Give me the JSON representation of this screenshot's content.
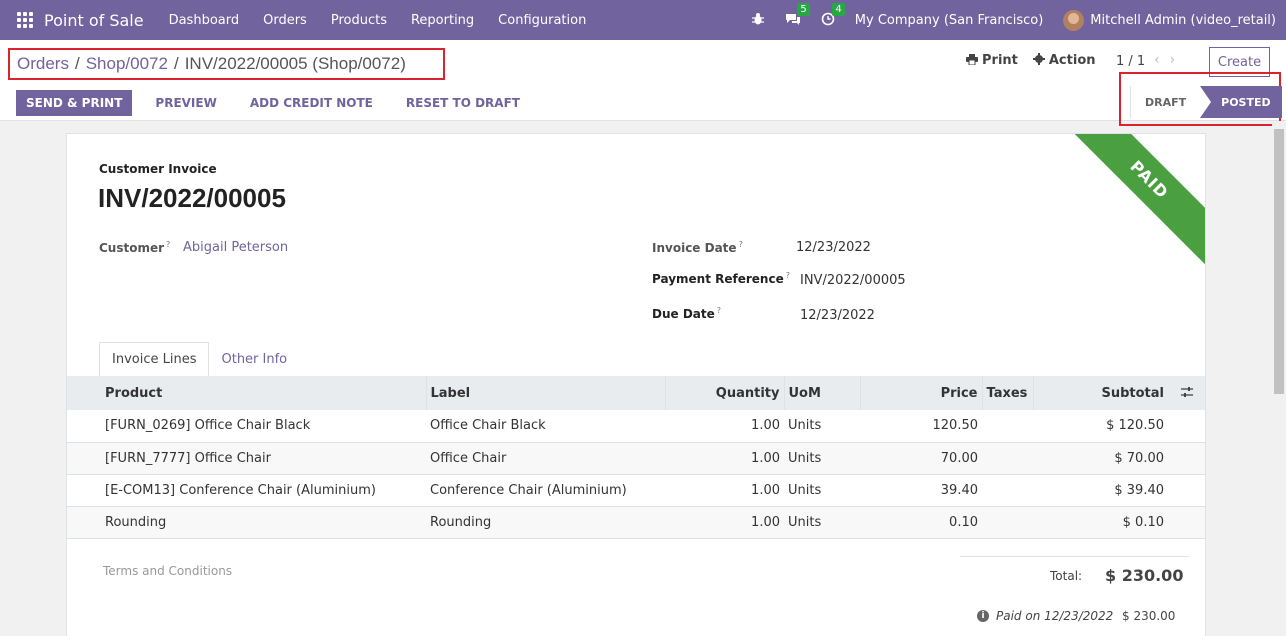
{
  "navbar": {
    "app_name": "Point of Sale",
    "menu": [
      "Dashboard",
      "Orders",
      "Products",
      "Reporting",
      "Configuration"
    ],
    "messages_count": "5",
    "activities_count": "4",
    "company": "My Company (San Francisco)",
    "user": "Mitchell Admin (video_retail)"
  },
  "breadcrumb": {
    "items": [
      "Orders",
      "Shop/0072"
    ],
    "current": "INV/2022/00005 (Shop/0072)"
  },
  "control": {
    "print_label": "Print",
    "action_label": "Action",
    "pager": "1 / 1",
    "create_label": "Create"
  },
  "buttons": {
    "send_print": "SEND & PRINT",
    "preview": "PREVIEW",
    "add_credit_note": "ADD CREDIT NOTE",
    "reset_to_draft": "RESET TO DRAFT"
  },
  "statusbar": {
    "draft": "DRAFT",
    "posted": "POSTED",
    "active": "POSTED"
  },
  "invoice": {
    "type": "Customer Invoice",
    "number": "INV/2022/00005",
    "ribbon": "PAID",
    "ribbon_color": "#4aa041",
    "customer_label": "Customer",
    "customer": "Abigail Peterson",
    "invoice_date_label": "Invoice Date",
    "invoice_date": "12/23/2022",
    "payment_ref_label": "Payment Reference",
    "payment_ref": "INV/2022/00005",
    "due_date_label": "Due Date",
    "due_date": "12/23/2022"
  },
  "tabs": [
    "Invoice Lines",
    "Other Info"
  ],
  "lines": {
    "headers": [
      "Product",
      "Label",
      "Quantity",
      "UoM",
      "Price",
      "Taxes",
      "Subtotal"
    ],
    "rows": [
      {
        "product": "[FURN_0269] Office Chair Black",
        "label": "Office Chair Black",
        "quantity": "1.00",
        "uom": "Units",
        "price": "120.50",
        "taxes": "",
        "subtotal": "$ 120.50"
      },
      {
        "product": "[FURN_7777] Office Chair",
        "label": "Office Chair",
        "quantity": "1.00",
        "uom": "Units",
        "price": "70.00",
        "taxes": "",
        "subtotal": "$ 70.00"
      },
      {
        "product": "[E-COM13] Conference Chair (Aluminium)",
        "label": "Conference Chair (Aluminium)",
        "quantity": "1.00",
        "uom": "Units",
        "price": "39.40",
        "taxes": "",
        "subtotal": "$ 39.40"
      },
      {
        "product": "Rounding",
        "label": "Rounding",
        "quantity": "1.00",
        "uom": "Units",
        "price": "0.10",
        "taxes": "",
        "subtotal": "$ 0.10"
      }
    ]
  },
  "footer": {
    "terms_placeholder": "Terms and Conditions",
    "total_label": "Total:",
    "total_value": "$ 230.00",
    "paid_text": "Paid on 12/23/2022",
    "paid_amount": "$ 230.00"
  },
  "colors": {
    "brand": "#71639e",
    "highlight_border": "#d9232d"
  }
}
